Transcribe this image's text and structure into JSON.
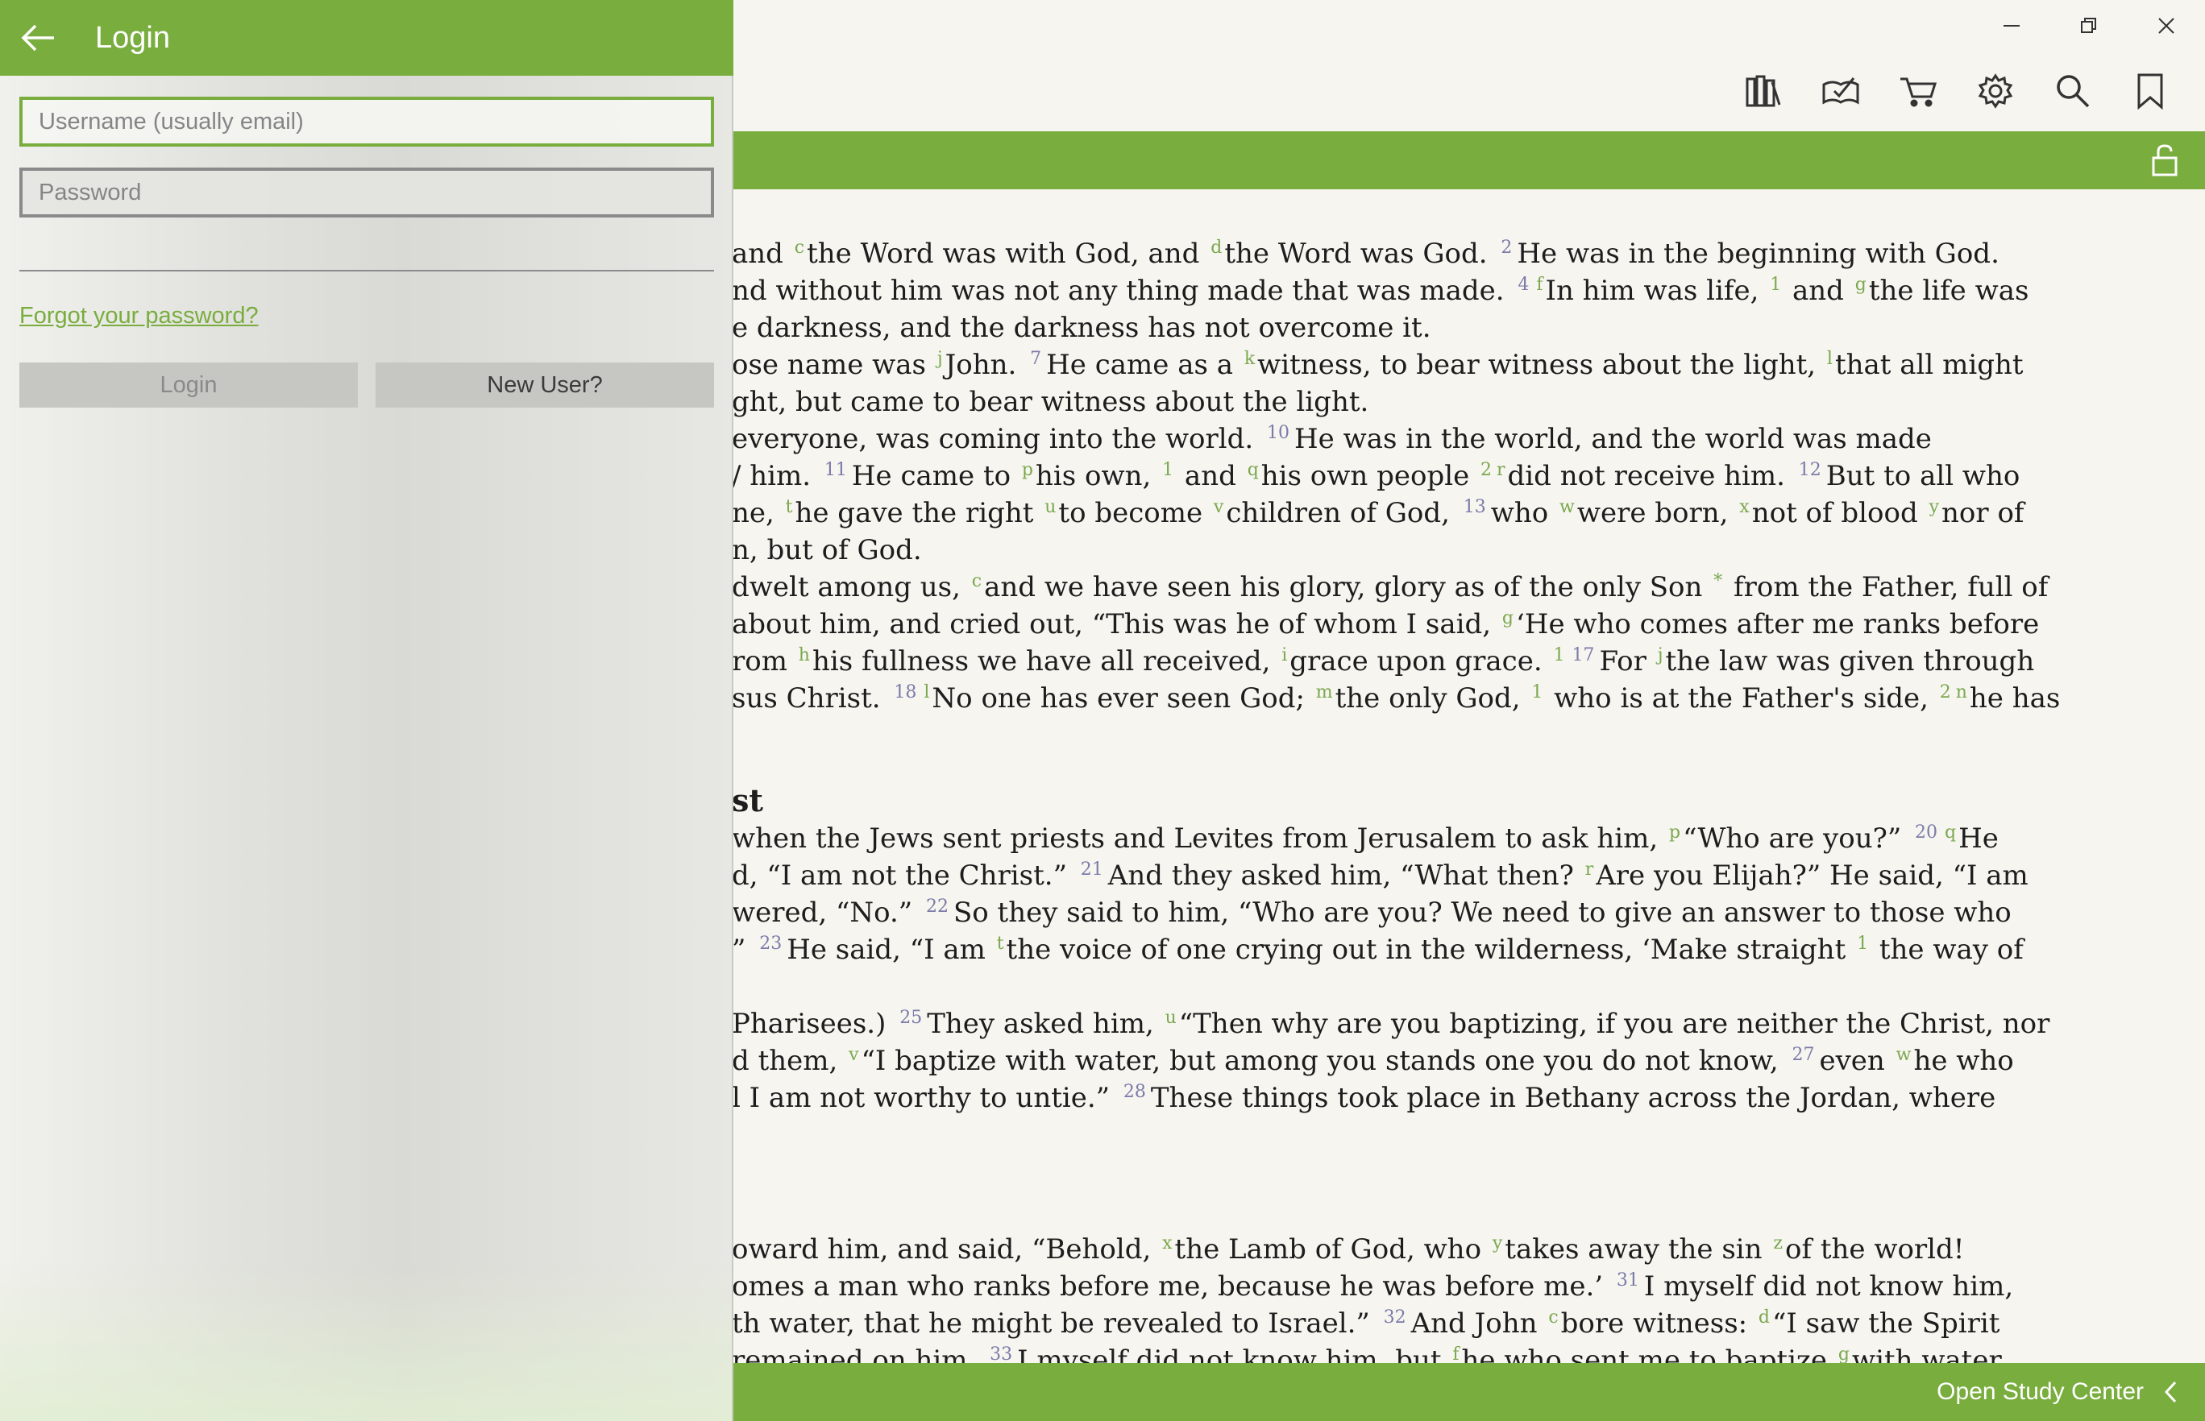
{
  "login": {
    "title": "Login",
    "username_placeholder": "Username (usually email)",
    "password_placeholder": "Password",
    "forgot_password": "Forgot your password?",
    "login_button": "Login",
    "new_user_button": "New User?"
  },
  "toolbar": {
    "icons": [
      "library-icon",
      "reading-plan-icon",
      "cart-icon",
      "gear-icon",
      "search-icon",
      "bookmark-icon"
    ]
  },
  "window": {
    "icons": [
      "minimize-icon",
      "restore-icon",
      "close-icon"
    ]
  },
  "footer": {
    "open_study_center": "Open Study Center"
  },
  "colors": {
    "accent": "#79ad3e",
    "verse_number": "#7b7ba9",
    "cross_reference": "#7ba84f",
    "background": "#f6f5f0"
  },
  "passage": {
    "heading_fragment": "st",
    "lines": [
      {
        "segments": [
          {
            "t": "and "
          },
          {
            "r": "c"
          },
          {
            "t": "the Word was with God, and "
          },
          {
            "r": "d"
          },
          {
            "t": "the Word was God. "
          },
          {
            "v": "2"
          },
          {
            "t": "He was in the beginning with God."
          }
        ]
      },
      {
        "segments": [
          {
            "t": "nd without him was not any thing made that was made. "
          },
          {
            "v": "4"
          },
          {
            "r": "f"
          },
          {
            "t": "In him was life, "
          },
          {
            "r": "1"
          },
          {
            "t": " and "
          },
          {
            "r": "g"
          },
          {
            "t": "the life was"
          }
        ]
      },
      {
        "segments": [
          {
            "t": "e darkness, and the darkness has not overcome it."
          }
        ]
      },
      {
        "segments": [
          {
            "t": "ose name was "
          },
          {
            "r": "j"
          },
          {
            "t": "John. "
          },
          {
            "v": "7"
          },
          {
            "t": "He came as a "
          },
          {
            "r": "k"
          },
          {
            "t": "witness, to bear witness about the light, "
          },
          {
            "r": "l"
          },
          {
            "t": "that all might"
          }
        ]
      },
      {
        "segments": [
          {
            "t": "ght, but came to bear witness about the light."
          }
        ]
      },
      {
        "segments": [
          {
            "t": "everyone, was coming into the world. "
          },
          {
            "v": "10"
          },
          {
            "t": "He was in the world, and the world was made"
          }
        ]
      },
      {
        "segments": [
          {
            "t": "/ him. "
          },
          {
            "v": "11"
          },
          {
            "t": "He came to "
          },
          {
            "r": "p"
          },
          {
            "t": "his own, "
          },
          {
            "r": "1"
          },
          {
            "t": " and "
          },
          {
            "r": "q"
          },
          {
            "t": "his own people "
          },
          {
            "r": "2"
          },
          {
            "r": "r"
          },
          {
            "t": "did not receive him. "
          },
          {
            "v": "12"
          },
          {
            "t": "But to all who"
          }
        ]
      },
      {
        "segments": [
          {
            "t": "ne, "
          },
          {
            "r": "t"
          },
          {
            "t": "he gave the right "
          },
          {
            "r": "u"
          },
          {
            "t": "to become "
          },
          {
            "r": "v"
          },
          {
            "t": "children of God, "
          },
          {
            "v": "13"
          },
          {
            "t": "who "
          },
          {
            "r": "w"
          },
          {
            "t": "were born, "
          },
          {
            "r": "x"
          },
          {
            "t": "not of blood "
          },
          {
            "r": "y"
          },
          {
            "t": "nor of"
          }
        ]
      },
      {
        "segments": [
          {
            "t": "n, but of God."
          }
        ]
      },
      {
        "segments": [
          {
            "t": "dwelt among us, "
          },
          {
            "r": "c"
          },
          {
            "t": "and we have seen his glory, glory as of the only Son "
          },
          {
            "r": "*"
          },
          {
            "t": " from the Father, full of"
          }
        ]
      },
      {
        "segments": [
          {
            "t": "about him, and cried out, “This was he of whom I said, "
          },
          {
            "r": "g"
          },
          {
            "t": "‘He who comes after me ranks before"
          }
        ]
      },
      {
        "segments": [
          {
            "t": "rom "
          },
          {
            "r": "h"
          },
          {
            "t": "his fullness we have all received, "
          },
          {
            "r": "i"
          },
          {
            "t": "grace upon grace. "
          },
          {
            "r": "1"
          },
          {
            "v": "17"
          },
          {
            "t": "For "
          },
          {
            "r": "j"
          },
          {
            "t": "the law was given through"
          }
        ]
      },
      {
        "segments": [
          {
            "t": "sus Christ. "
          },
          {
            "v": "18"
          },
          {
            "r": "l"
          },
          {
            "t": "No one has ever seen God; "
          },
          {
            "r": "m"
          },
          {
            "t": "the only God, "
          },
          {
            "r": "1"
          },
          {
            "t": " who is at the Father's side, "
          },
          {
            "r": "2"
          },
          {
            "r": "n"
          },
          {
            "t": "he has"
          }
        ]
      },
      {
        "segments": [
          {
            "t": "when the Jews sent priests and Levites from Jerusalem to ask him, "
          },
          {
            "r": "p"
          },
          {
            "t": "“Who are you?” "
          },
          {
            "v": "20"
          },
          {
            "r": "q"
          },
          {
            "t": "He"
          }
        ]
      },
      {
        "segments": [
          {
            "t": "d, “I am not the Christ.” "
          },
          {
            "v": "21"
          },
          {
            "t": "And they asked him, “What then? "
          },
          {
            "r": "r"
          },
          {
            "t": "Are you Elijah?” He said, “I am"
          }
        ]
      },
      {
        "segments": [
          {
            "t": "wered, “No.” "
          },
          {
            "v": "22"
          },
          {
            "t": "So they said to him, “Who are you? We need to give an answer to those who"
          }
        ]
      },
      {
        "segments": [
          {
            "t": "” "
          },
          {
            "v": "23"
          },
          {
            "t": "He said, “I am "
          },
          {
            "r": "t"
          },
          {
            "t": "the voice of one crying out in the wilderness, ‘Make straight "
          },
          {
            "r": "1"
          },
          {
            "t": " the way of"
          }
        ]
      },
      {
        "segments": [
          {
            "t": "Pharisees.) "
          },
          {
            "v": "25"
          },
          {
            "t": "They asked him, "
          },
          {
            "r": "u"
          },
          {
            "t": "“Then why are you baptizing, if you are neither the Christ, nor"
          }
        ]
      },
      {
        "segments": [
          {
            "t": "d them, "
          },
          {
            "r": "v"
          },
          {
            "t": "“I baptize with water, but among you stands one you do not know, "
          },
          {
            "v": "27"
          },
          {
            "t": "even "
          },
          {
            "r": "w"
          },
          {
            "t": "he who"
          }
        ]
      },
      {
        "segments": [
          {
            "t": "l I am not worthy to untie.” "
          },
          {
            "v": "28"
          },
          {
            "t": "These things took place in Bethany across the Jordan, where"
          }
        ]
      },
      {
        "segments": [
          {
            "t": "oward him, and said, “Behold, "
          },
          {
            "r": "x"
          },
          {
            "t": "the Lamb of God, who "
          },
          {
            "r": "y"
          },
          {
            "t": "takes away the sin "
          },
          {
            "r": "z"
          },
          {
            "t": "of the world!"
          }
        ]
      },
      {
        "segments": [
          {
            "t": "omes a man who ranks before me, because he was before me.’ "
          },
          {
            "v": "31"
          },
          {
            "t": "I myself did not know him,"
          }
        ]
      },
      {
        "segments": [
          {
            "t": "th water, that he might be revealed to Israel.” "
          },
          {
            "v": "32"
          },
          {
            "t": "And John "
          },
          {
            "r": "c"
          },
          {
            "t": "bore witness: "
          },
          {
            "r": "d"
          },
          {
            "t": "“I saw the Spirit"
          }
        ]
      },
      {
        "segments": [
          {
            "t": "remained on him. "
          },
          {
            "v": "33"
          },
          {
            "t": "I myself did not know him, but "
          },
          {
            "r": "f"
          },
          {
            "t": "he who sent me to baptize "
          },
          {
            "r": "g"
          },
          {
            "t": "with water"
          }
        ]
      }
    ]
  }
}
